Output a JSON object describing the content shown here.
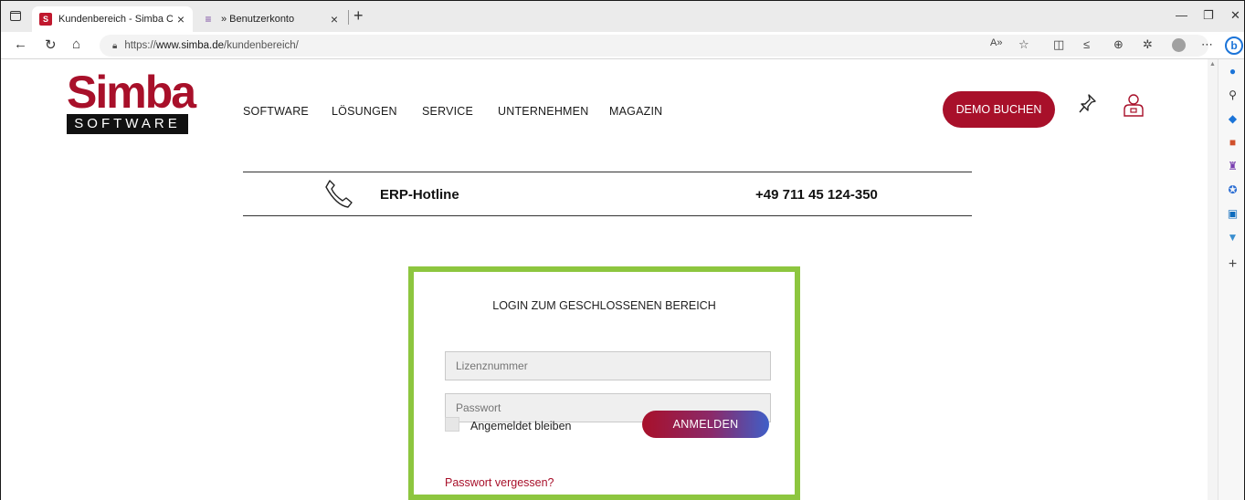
{
  "browser": {
    "tabs": [
      {
        "favicon": "simba-favicon",
        "title": "Kundenbereich - Simba Compute",
        "active": true
      },
      {
        "favicon": "list-favicon",
        "title": "» Benutzerkonto",
        "active": false
      }
    ],
    "url": {
      "scheme": "https://",
      "host": "www.simba.de",
      "path": "/kundenbereich/"
    }
  },
  "site": {
    "logo": {
      "line1": "Simba",
      "line2": "SOFTWARE"
    },
    "nav": [
      "SOFTWARE",
      "LÖSUNGEN",
      "SERVICE",
      "UNTERNEHMEN",
      "MAGAZIN"
    ],
    "demo_button": "DEMO BUCHEN",
    "hotline": {
      "label": "ERP-Hotline",
      "number": "+49 711 45 124-350"
    }
  },
  "login": {
    "title": "LOGIN ZUM GESCHLOSSENEN BEREICH",
    "license_placeholder": "Lizenznummer",
    "password_placeholder": "Passwort",
    "remember_label": "Angemeldet bleiben",
    "submit_label": "ANMELDEN",
    "forgot_link": "Passwort vergessen?"
  },
  "colors": {
    "brand": "#a8102a",
    "highlight": "#8dc63f"
  }
}
